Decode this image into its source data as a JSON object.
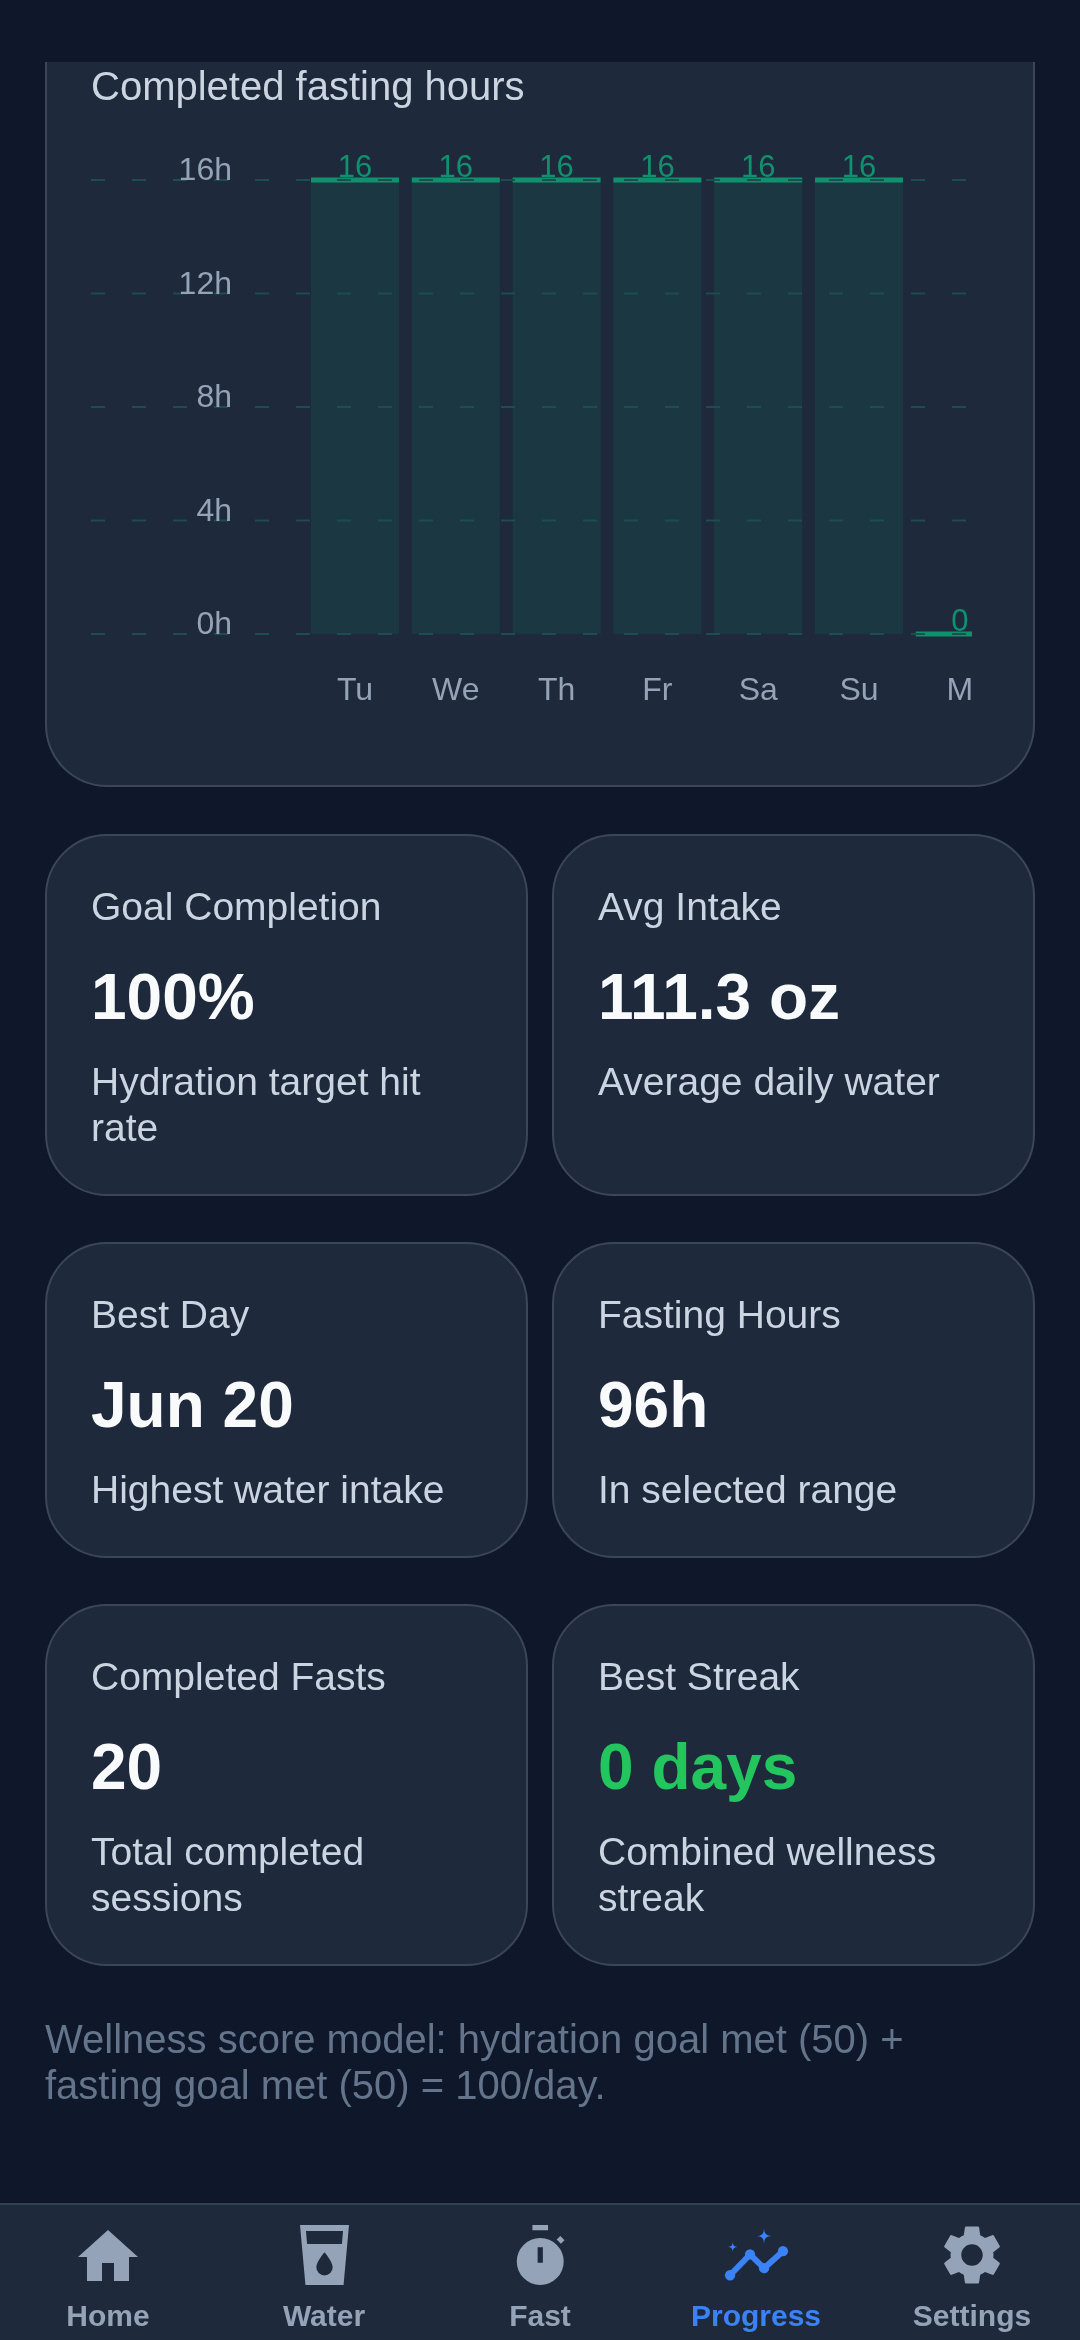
{
  "progress_chart": {
    "chart_data": {
      "type": "bar",
      "title": "Completed fasting hours",
      "categories": [
        "Tu",
        "We",
        "Th",
        "Fr",
        "Sa",
        "Su",
        "M"
      ],
      "series": [
        {
          "color": "#10916e",
          "values": [
            16,
            16,
            16,
            16,
            16,
            16,
            0
          ]
        }
      ],
      "ylim": [
        0,
        16
      ],
      "yticks": [
        {
          "value": 0,
          "label": "0h"
        },
        {
          "value": 4,
          "label": "4h"
        },
        {
          "value": 8,
          "label": "8h"
        },
        {
          "value": 12,
          "label": "12h"
        },
        {
          "value": 16,
          "label": "16h"
        }
      ],
      "grid": true,
      "data_labels": true
    }
  },
  "stats": [
    {
      "label": "Goal Completion",
      "value": "100%",
      "caption": "Hydration target hit rate",
      "color": "#f8fafc"
    },
    {
      "label": "Avg Intake",
      "value": "111.3 oz",
      "caption": "Average daily water",
      "color": "#f8fafc"
    },
    {
      "label": "Best Day",
      "value": "Jun 20",
      "caption": "Highest water intake",
      "color": "#f8fafc"
    },
    {
      "label": "Fasting Hours",
      "value": "96h",
      "caption": "In selected range",
      "color": "#f8fafc"
    },
    {
      "label": "Completed Fasts",
      "value": "20",
      "caption": "Total completed sessions",
      "color": "#f8fafc"
    },
    {
      "label": "Best Streak",
      "value": "0 days",
      "caption": "Combined wellness streak",
      "color": "#22c55e"
    }
  ],
  "footnote": "Wellness score model: hydration goal met (50) + fasting goal met (50) = 100/day.",
  "nav": [
    {
      "label": "Home",
      "selected": false
    },
    {
      "label": "Water",
      "selected": false
    },
    {
      "label": "Fast",
      "selected": false
    },
    {
      "label": "Progress",
      "selected": true
    },
    {
      "label": "Settings",
      "selected": false
    }
  ]
}
